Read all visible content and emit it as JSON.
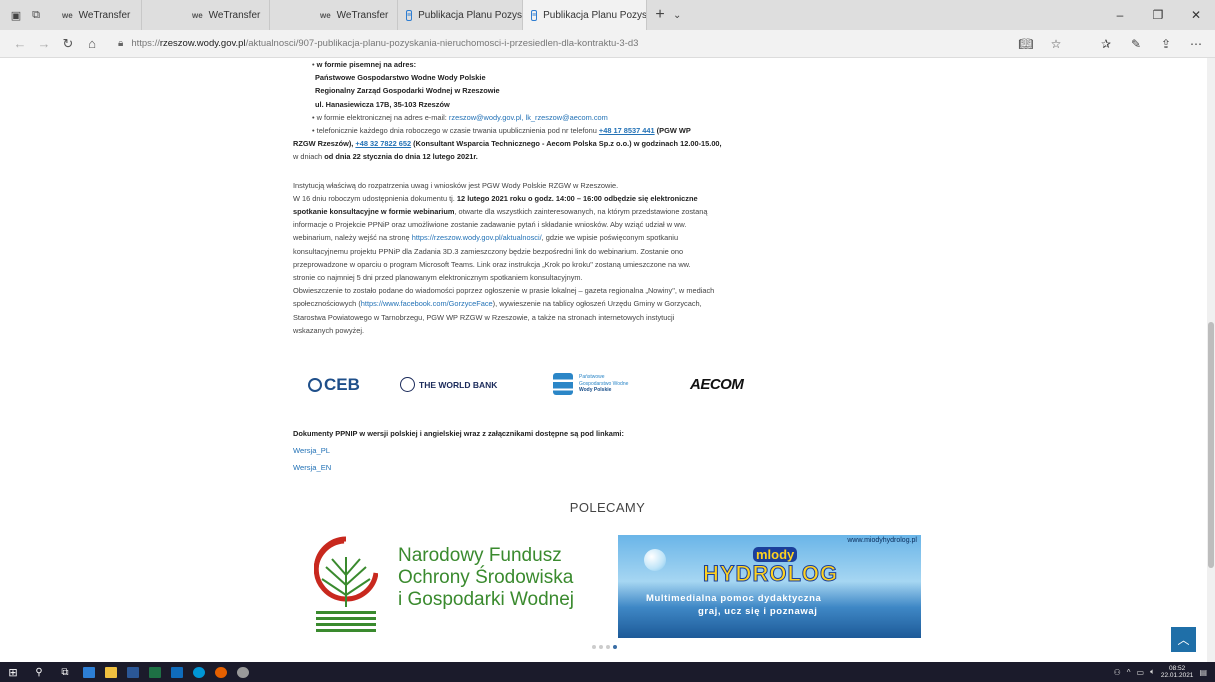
{
  "browser": {
    "tabs": [
      {
        "label": "WeTransfer",
        "favicon": "we-logo",
        "active": false
      },
      {
        "label": "WeTransfer",
        "favicon": "we-logo",
        "active": false
      },
      {
        "label": "WeTransfer",
        "favicon": "we-logo",
        "active": false
      },
      {
        "label": "Publikacja Planu Pozyskania",
        "favicon": "page-icon",
        "active": false
      },
      {
        "label": "Publikacja Planu Pozysk",
        "favicon": "page-icon",
        "active": true
      }
    ],
    "url_prefix": "https://",
    "url_domain": "rzeszow.wody.gov.pl",
    "url_path": "/aktualnosci/907-publikacja-planu-pozyskania-nieruchomosci-i-przesiedlen-dla-kontraktu-3-d3"
  },
  "article": {
    "written_bullet": "w formie pisemnej na adres:",
    "addr1": "Państwowe Gospodarstwo Wodne Wody Polskie",
    "addr2": "Regionalny Zarząd Gospodarki Wodnej w Rzeszowie",
    "addr3": "ul. Hanasiewicza 17B, 35-103 Rzeszów",
    "email_bullet": "w formie elektronicznej na adres e-mail: ",
    "email_link": "rzeszow@wody.gov.pl, lk_rzeszow@aecom.com",
    "phone_bullet": "telefonicznie każdego dnia roboczego w czasie trwania upublicznienia pod nr telefonu ",
    "phone1": "+48 17 8537 441",
    "phone1_after": " (PGW WP",
    "phone_line2_start": "RZGW Rzeszów), ",
    "phone2": "+48 32 7822 652",
    "phone2_after": " (Konsultant Wsparcia Technicznego - Aecom Polska Sp.z o.o.) w godzinach 12.00-15.00,",
    "phone_line3_start": "w dniach ",
    "phone_dates": "od dnia 22 stycznia do dnia 12 lutego 2021r.",
    "institution": "Instytucją właściwą do rozpatrzenia uwag i wniosków jest PGW Wody Polskie RZGW w Rzeszowie.",
    "webinar_p1": "W 16 dniu roboczym udostępnienia dokumentu tj. ",
    "webinar_bold1": "12 lutego 2021 roku o godz. 14:00 – 16:00 odbędzie się elektroniczne",
    "webinar_bold2": "spotkanie konsultacyjne w formie webinarium",
    "webinar_p2": ", otwarte dla wszystkich zainteresowanych, na którym przedstawione zostaną",
    "webinar_line3": "informacje o Projekcie PPNiP oraz umożliwione zostanie zadawanie pytań i składanie wniosków. Aby wziąć udział w ww.",
    "webinar_line4a": "webinarium, należy wejść na stronę ",
    "webinar_link": "https://rzeszow.wody.gov.pl/aktualnosci/",
    "webinar_line4b": ", gdzie we wpisie poświęconym spotkaniu",
    "webinar_line5": "konsultacyjnemu projektu PPNiP  dla Zadania 3D.3 zamieszczony będzie bezpośredni link do webinarium. Zostanie ono",
    "webinar_line6": "przeprowadzone w oparciu o program Microsoft Teams. Link oraz instrukcja „Krok po kroku\" zostaną umieszczone na ww.",
    "webinar_line7": "stronie co najmniej 5 dni przed planowanym elektronicznym spotkaniem konsultacyjnym.",
    "notice_line1": "Obwieszczenie to zostało podane do wiadomości poprzez ogłoszenie w prasie lokalnej – gazeta regionalna „Nowiny\",  w mediach",
    "notice_line2a": "społecznościowych (",
    "notice_link": "https://www.facebook.com/GorzyceFace",
    "notice_line2b": "), wywieszenie na tablicy ogłoszeń Urzędu Gminy w Gorzycach,",
    "notice_line3": "Starostwa Powiatowego w Tarnobrzegu, PGW WP RZGW w Rzeszowie, a także na stronach internetowych instytucji",
    "notice_line4": "wskazanych powyżej.",
    "docs_heading": "Dokumenty PPNIP w wersji polskiej i angielskiej wraz z załącznikami dostępne są pod linkami:",
    "link_pl": "Wersja_PL",
    "link_en": "Wersja_EN"
  },
  "logos": {
    "ceb": "CEB",
    "worldbank": "THE WORLD BANK",
    "wp_line1": "Państwowe",
    "wp_line2": "Gospodarstwo Wodne",
    "wp_line3": "Wody Polskie",
    "aecom": "AECOM"
  },
  "recommend": {
    "heading": "POLECAMY",
    "nfos_line1": "Narodowy Fundusz",
    "nfos_line2": "Ochrony Środowiska",
    "nfos_line3": "i Gospodarki Wodnej",
    "hydro_url": "www.miodyhydrolog.pl",
    "hydro_mlody": "mlody",
    "hydro_title": "HYDROLOG",
    "hydro_t1": "Multimedialna pomoc dydaktyczna",
    "hydro_t2": "graj, ucz się i poznawaj"
  },
  "taskbar": {
    "time": "08:52",
    "date": "22.01.2021"
  }
}
